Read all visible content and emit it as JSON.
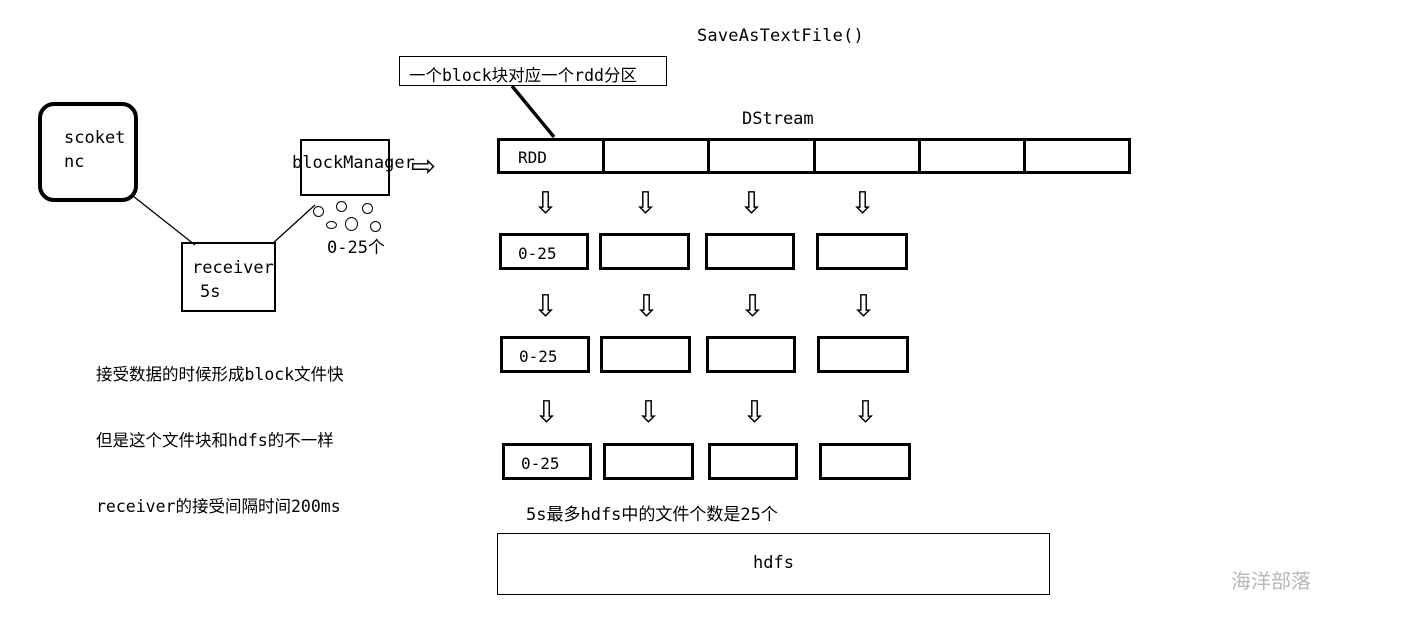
{
  "diagram": {
    "title_note": "SaveAsTextFile()",
    "callout": {
      "text": "一个block块对应一个rdd分区"
    },
    "source_box": {
      "line1": "scoket",
      "line2": "nc"
    },
    "receiver_box": {
      "line1": "receiver",
      "line2": "5s"
    },
    "block_manager": {
      "label": "blockManager",
      "blob_count_label": "0-25个"
    },
    "description": {
      "line1": "接受数据的时候形成block文件快",
      "line2": "但是这个文件块和hdfs的不一样",
      "line3": "receiver的接受间隔时间200ms"
    },
    "dstream": {
      "label": "DStream",
      "cells": [
        {
          "label": "RDD"
        },
        {
          "label": ""
        },
        {
          "label": ""
        },
        {
          "label": ""
        },
        {
          "label": ""
        },
        {
          "label": ""
        }
      ]
    },
    "stage_rows": [
      {
        "boxes": [
          {
            "label": "0-25"
          },
          {
            "label": ""
          },
          {
            "label": ""
          },
          {
            "label": ""
          }
        ]
      },
      {
        "boxes": [
          {
            "label": "0-25"
          },
          {
            "label": ""
          },
          {
            "label": ""
          },
          {
            "label": ""
          }
        ]
      },
      {
        "boxes": [
          {
            "label": "0-25"
          },
          {
            "label": ""
          },
          {
            "label": ""
          },
          {
            "label": ""
          }
        ]
      }
    ],
    "hdfs": {
      "note": "5s最多hdfs中的文件个数是25个",
      "label": "hdfs"
    },
    "arrows": {
      "down_glyph": "⇩",
      "right_glyph": "⇨"
    },
    "watermark": "海洋部落",
    "colors": {
      "stroke": "#000000",
      "background": "#ffffff",
      "watermark": "#b8b8b8"
    }
  }
}
